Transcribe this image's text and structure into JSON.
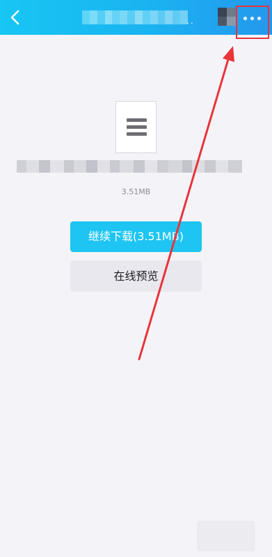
{
  "header": {
    "back_icon": "chevron-left-icon",
    "title_ellipsis": "..",
    "more_icon": "more-horizontal-icon",
    "gradient_colors": [
      "#17c6f3",
      "#2498ee"
    ]
  },
  "file": {
    "icon": "document-lines-icon",
    "size": "3.51MB"
  },
  "actions": {
    "download_label": "继续下载(3.51MB)",
    "preview_label": "在线预览"
  },
  "colors": {
    "primary_button": "#1ec5f3",
    "secondary_button": "#e8e8ee",
    "annotation_red": "#e8343a",
    "background": "#f4f4f8"
  }
}
